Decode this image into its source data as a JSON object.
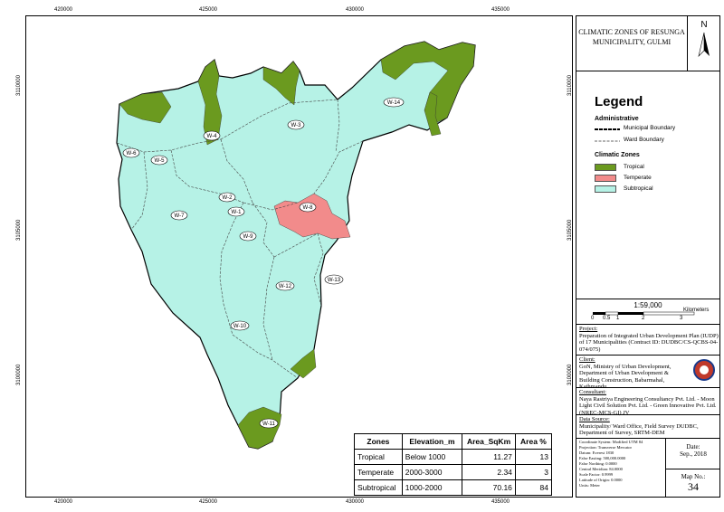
{
  "map": {
    "title": "CLIMATIC ZONES OF RESUNGA MUNICIPALITY, GULMI",
    "north_label": "N",
    "grid": {
      "x_ticks": [
        "420000",
        "425000",
        "430000",
        "435000"
      ],
      "y_ticks": [
        "3110000",
        "3105000",
        "3100000"
      ]
    },
    "ward_labels": [
      "W-14",
      "W-3",
      "W-4",
      "W-6",
      "W-5",
      "W-2",
      "W-1",
      "W-8",
      "W-7",
      "W-9",
      "W-12",
      "W-13",
      "W-10",
      "W-11"
    ],
    "colors": {
      "tropical": "#6b9a1f",
      "temperate": "#f28b8b",
      "subtropical": "#b6f2e6"
    }
  },
  "legend": {
    "title": "Legend",
    "administrative_heading": "Administrative",
    "municipal_boundary": "Municipal Boundary",
    "ward_boundary": "Ward Boundary",
    "climatic_heading": "Climatic Zones",
    "zones": [
      "Tropical",
      "Temperate",
      "Subtropical"
    ]
  },
  "scale": {
    "ratio": "1:59,000",
    "ticks": [
      "0",
      "0.5",
      "1",
      "2",
      "3"
    ],
    "unit": "Kilometers"
  },
  "project": {
    "heading": "Project:",
    "text": "Preparation of Integrated Urban Development Plan (IUDP) of 17 Municipalities (Contract ID: DUDBC/CS-QCBS-04-074/075)"
  },
  "client": {
    "heading": "Client:",
    "text": "GoN, Ministry of Urban Development, Department of Urban Development & Building Construction, Babarmahal, Kathmandu"
  },
  "consultant": {
    "heading": "Consultant:",
    "text": "Naya Rastriya Engineering Consultancy Pvt. Ltd. - Moon Light Civil Solution Pvt. Ltd. - Green Innovative Pvt. Ltd. (NREC-MCS-GI) JV"
  },
  "data_source": {
    "heading": "Data Source:",
    "text": "Municipality/ Ward Office, Field Survey DUDBC, Department of Survey, SRTM-DEM"
  },
  "projection": [
    "Coordinate System: Modified UTM 84",
    "Projection: Transverse Mercator",
    "Datum: Everest 1830",
    "False Easting: 500,000.0000",
    "False Northing: 0.0000",
    "Central Meridian: 84.0000",
    "Scale Factor: 0.9999",
    "Latitude of Origin: 0.0000",
    "Units: Meter"
  ],
  "date": {
    "label": "Date:",
    "value": "Sep., 2018"
  },
  "map_no": {
    "label": "Map No.:",
    "value": "34"
  },
  "zone_table": {
    "headers": [
      "Zones",
      "Elevation_m",
      "Area_SqKm",
      "Area %"
    ],
    "rows": [
      [
        "Tropical",
        "Below 1000",
        "11.27",
        "13"
      ],
      [
        "Temperate",
        "2000-3000",
        "2.34",
        "3"
      ],
      [
        "Subtropical",
        "1000-2000",
        "70.16",
        "84"
      ]
    ]
  }
}
